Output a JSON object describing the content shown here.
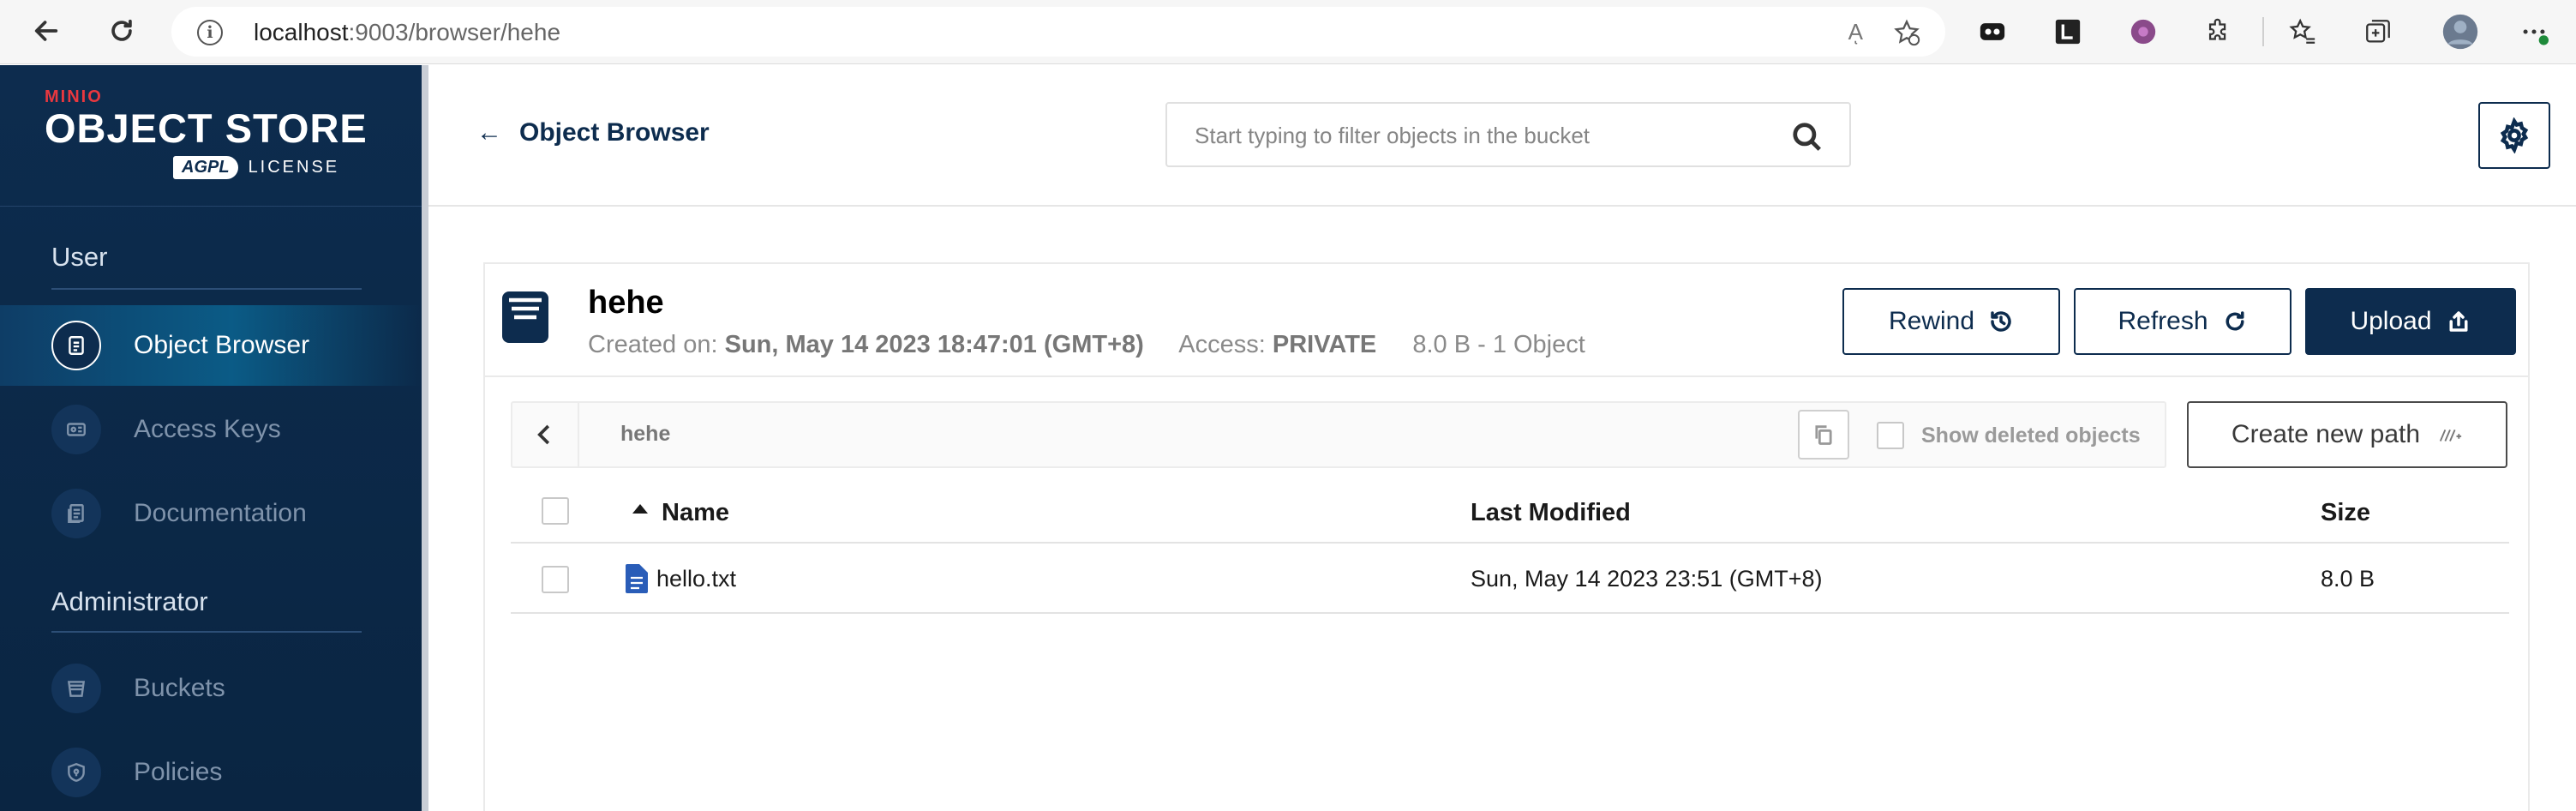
{
  "browser": {
    "url_host": "localhost",
    "url_path": ":9003/browser/hehe",
    "read_aloud": "Aͅ",
    "back_icon": "back-arrow-icon",
    "refresh_icon": "reload-icon"
  },
  "sidebar": {
    "logo": {
      "brand": "MINIO",
      "product": "OBJECT STORE",
      "badge": "AGPL",
      "license": "LICENSE"
    },
    "sections": [
      {
        "title": "User",
        "items": [
          {
            "label": "Object Browser",
            "icon": "folder-icon",
            "active": true
          },
          {
            "label": "Access Keys",
            "icon": "key-card-icon",
            "active": false
          },
          {
            "label": "Documentation",
            "icon": "docs-icon",
            "active": false
          }
        ]
      },
      {
        "title": "Administrator",
        "items": [
          {
            "label": "Buckets",
            "icon": "bucket-icon",
            "active": false
          },
          {
            "label": "Policies",
            "icon": "shield-icon",
            "active": false
          }
        ]
      }
    ]
  },
  "header": {
    "back_label": "Object Browser",
    "search_placeholder": "Start typing to filter objects in the bucket"
  },
  "bucket": {
    "name": "hehe",
    "created_label": "Created on:",
    "created_value": "Sun, May 14 2023 18:47:01 (GMT+8)",
    "access_label": "Access:",
    "access_value": "PRIVATE",
    "size_summary": "8.0 B - 1 Object",
    "buttons": {
      "rewind": "Rewind",
      "refresh": "Refresh",
      "upload": "Upload"
    }
  },
  "path_bar": {
    "path": "hehe",
    "show_deleted_label": "Show deleted objects",
    "create_new_path": "Create new path"
  },
  "table": {
    "columns": {
      "name": "Name",
      "last_modified": "Last Modified",
      "size": "Size"
    },
    "rows": [
      {
        "name": "hello.txt",
        "last_modified": "Sun, May 14 2023 23:51 (GMT+8)",
        "size": "8.0 B"
      }
    ]
  },
  "colors": {
    "sidebar_bg": "#0d2c4e",
    "accent_red": "#e9383f",
    "primary": "#0d2c4e"
  }
}
